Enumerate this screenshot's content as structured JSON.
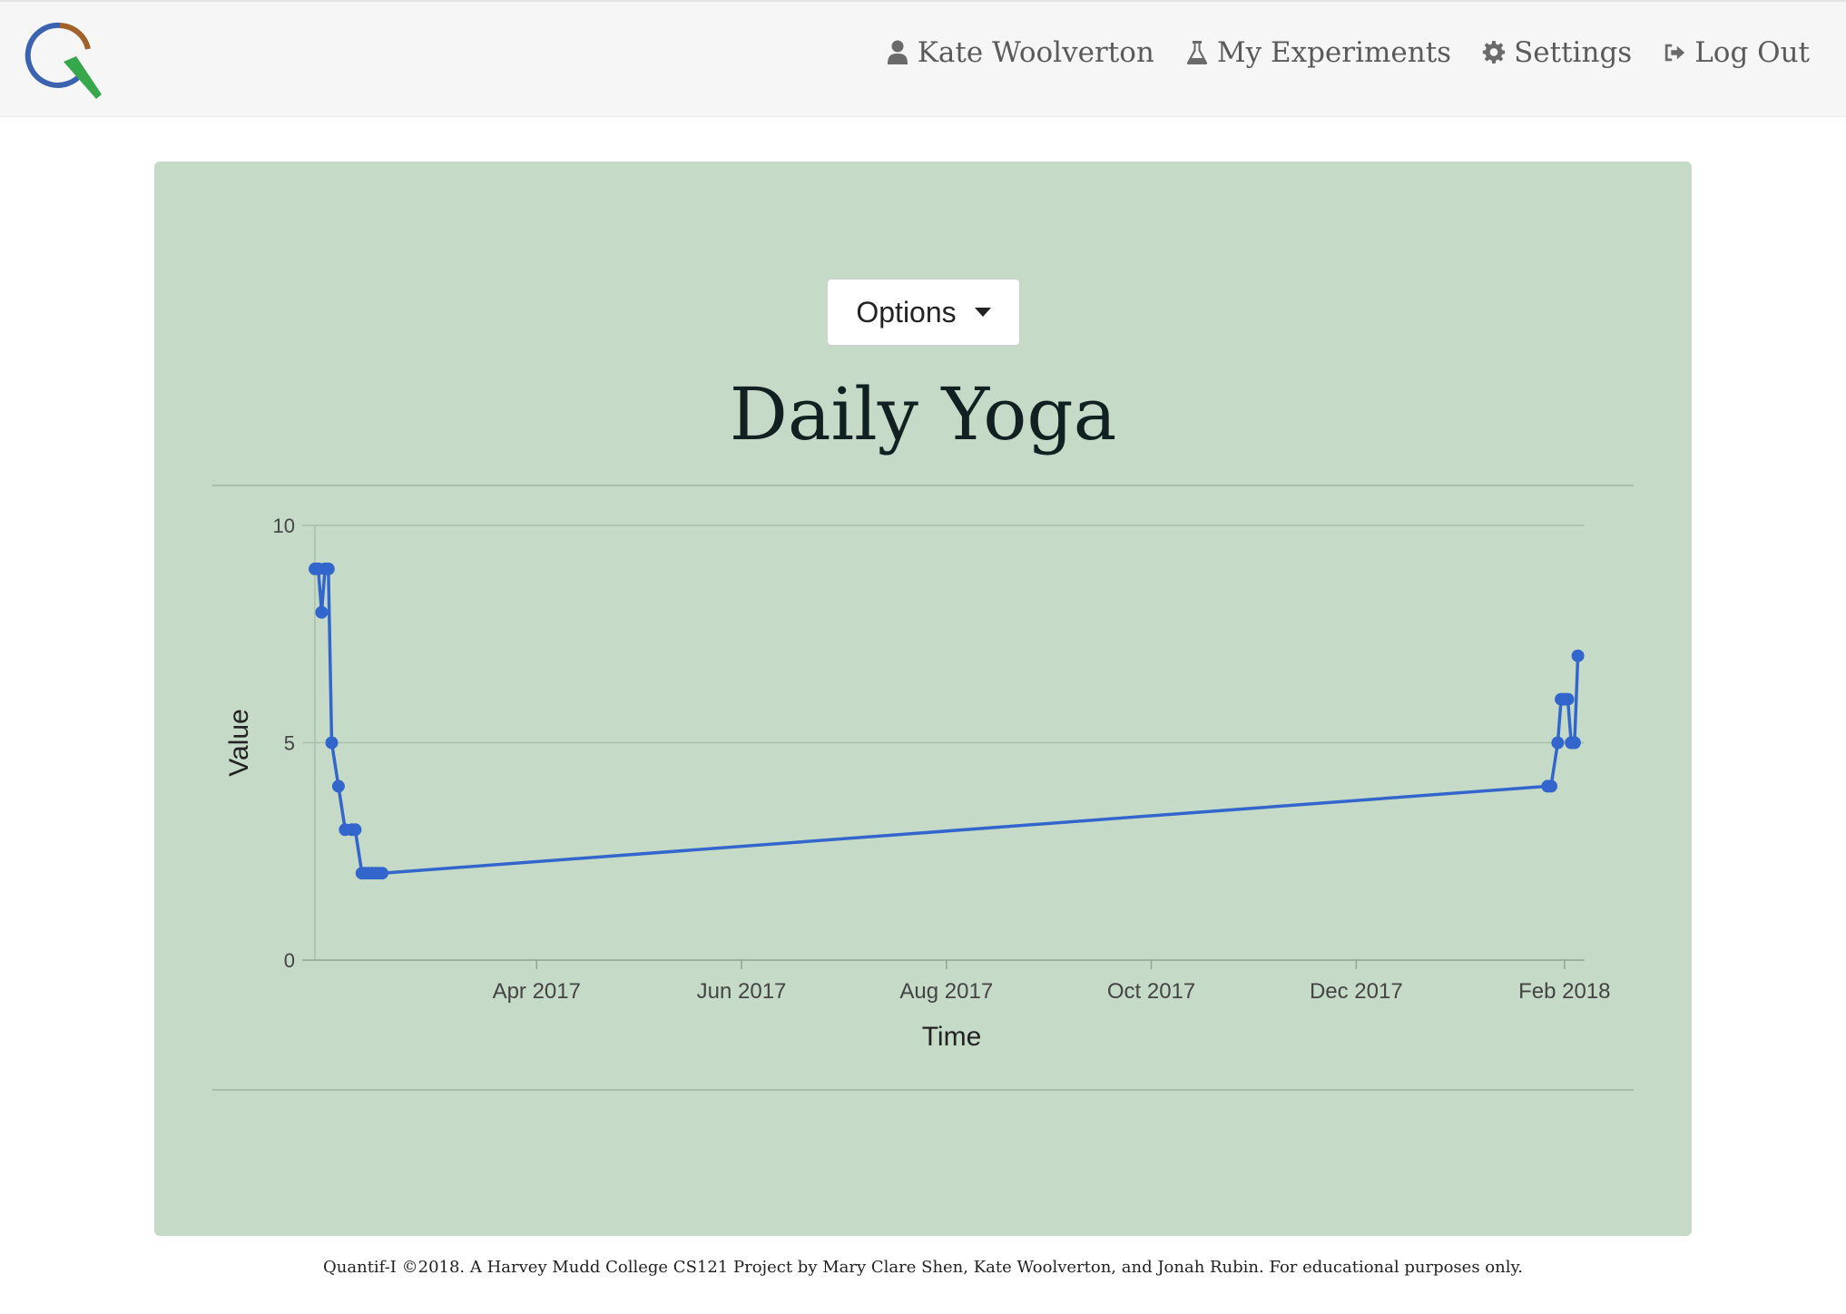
{
  "nav": {
    "logo_icon": "quantifi-logo",
    "links": [
      {
        "label": "Kate Woolverton",
        "icon": "user-icon"
      },
      {
        "label": "My Experiments",
        "icon": "flask-icon"
      },
      {
        "label": "Settings",
        "icon": "gear-icon"
      },
      {
        "label": "Log Out",
        "icon": "sign-out-icon"
      }
    ]
  },
  "panel": {
    "options_label": "Options",
    "title": "Daily Yoga"
  },
  "chart_data": {
    "type": "line",
    "title": "Daily Yoga",
    "xlabel": "Time",
    "ylabel": "Value",
    "ylim": [
      0,
      10
    ],
    "xlim": [
      "2017-01-25",
      "2018-02-07"
    ],
    "x_ticks": [
      "Apr 2017",
      "Jun 2017",
      "Aug 2017",
      "Oct 2017",
      "Dec 2017",
      "Feb 2018"
    ],
    "y_ticks": [
      0,
      5,
      10
    ],
    "grid": true,
    "series": [
      {
        "color": "#3366cc",
        "points": [
          {
            "x": "2017-01-25",
            "y": 9
          },
          {
            "x": "2017-01-26",
            "y": 9
          },
          {
            "x": "2017-01-27",
            "y": 8
          },
          {
            "x": "2017-01-28",
            "y": 9
          },
          {
            "x": "2017-01-29",
            "y": 9
          },
          {
            "x": "2017-01-30",
            "y": 5
          },
          {
            "x": "2017-02-01",
            "y": 4
          },
          {
            "x": "2017-02-03",
            "y": 3
          },
          {
            "x": "2017-02-05",
            "y": 3
          },
          {
            "x": "2017-02-06",
            "y": 3
          },
          {
            "x": "2017-02-08",
            "y": 2
          },
          {
            "x": "2017-02-09",
            "y": 2
          },
          {
            "x": "2017-02-10",
            "y": 2
          },
          {
            "x": "2017-02-11",
            "y": 2
          },
          {
            "x": "2017-02-12",
            "y": 2
          },
          {
            "x": "2017-02-13",
            "y": 2
          },
          {
            "x": "2017-02-14",
            "y": 2
          },
          {
            "x": "2018-01-27",
            "y": 4
          },
          {
            "x": "2018-01-28",
            "y": 4
          },
          {
            "x": "2018-01-30",
            "y": 5
          },
          {
            "x": "2018-01-31",
            "y": 6
          },
          {
            "x": "2018-02-01",
            "y": 6
          },
          {
            "x": "2018-02-02",
            "y": 6
          },
          {
            "x": "2018-02-03",
            "y": 5
          },
          {
            "x": "2018-02-04",
            "y": 5
          },
          {
            "x": "2018-02-05",
            "y": 7
          }
        ]
      }
    ]
  },
  "footer": {
    "text": "Quantif-I ©2018. A Harvey Mudd College CS121 Project by Mary Clare Shen, Kate Woolverton, and Jonah Rubin. For educational purposes only."
  }
}
